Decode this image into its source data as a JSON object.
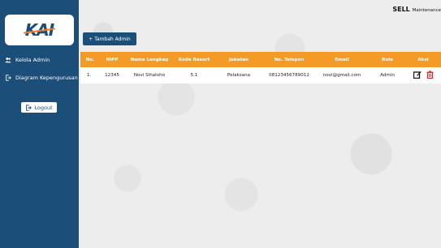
{
  "sidebar": {
    "logo_text": "KAI",
    "items": [
      {
        "label": "Kelola Admin",
        "icon": "users-icon"
      },
      {
        "label": "Diagram Kepengurusan",
        "icon": "logout-arrow-icon"
      }
    ],
    "logout_label": "Logout"
  },
  "header": {
    "brand": "SELL",
    "brand_sub": "Maintenance"
  },
  "main": {
    "add_button_label": "+ Tambah Admin",
    "table": {
      "columns": [
        "No.",
        "NIPP",
        "Nama Lengkap",
        "Kode Resort",
        "Jabatan",
        "No. Telepon",
        "Email",
        "Role",
        "Aksi"
      ],
      "rows": [
        {
          "no": "1.",
          "nipp": "12345",
          "nama": "Novi Sihaloho",
          "kode": "5.1",
          "jabatan": "Pelaksana",
          "telepon": "08123456789012",
          "email": "novi@gmail.com",
          "role": "Admin"
        }
      ]
    }
  },
  "colors": {
    "sidebar": "#1b4f79",
    "table_header": "#f49a26",
    "delete": "#d7262c"
  }
}
